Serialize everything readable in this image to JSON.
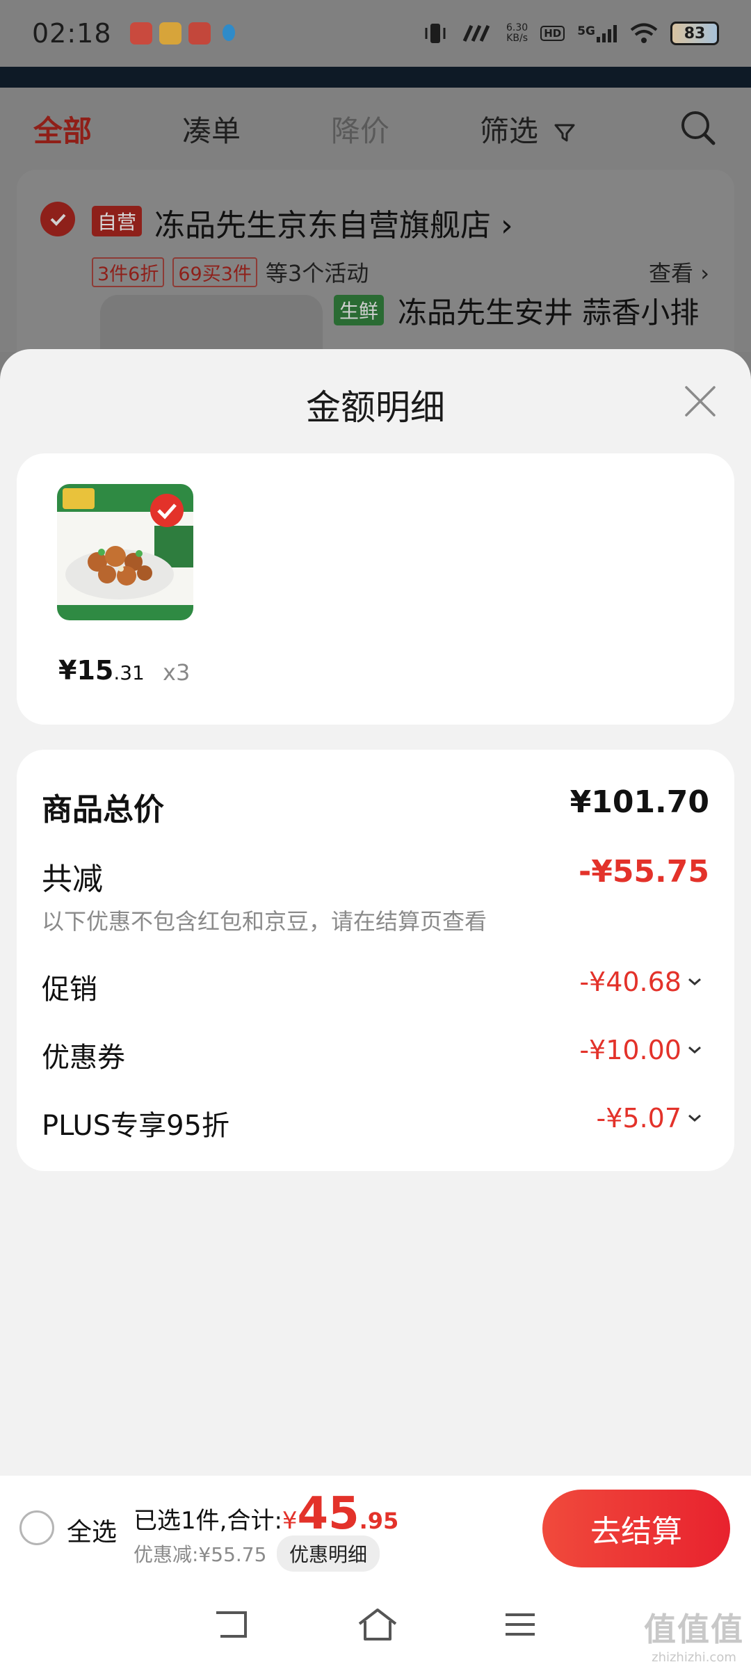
{
  "status_bar": {
    "time": "02:18",
    "net_speed_top": "6.30",
    "net_speed_bottom": "KB/s",
    "hd": "HD",
    "network": "5G",
    "battery": "83"
  },
  "tabs": [
    {
      "label": "全部"
    },
    {
      "label": "凑单"
    },
    {
      "label": "降价"
    },
    {
      "label": "筛选"
    }
  ],
  "store": {
    "badge": "自营",
    "name": "冻品先生京东自营旗舰店 ›",
    "promos": [
      "3件6折",
      "69买3件"
    ],
    "promo_more": "等3个活动",
    "view": "查看 ›",
    "fresh_badge": "生鲜",
    "product_name": "冻品先生安井 蒜香小排"
  },
  "sheet": {
    "title": "金额明细",
    "item": {
      "price_main": "¥15",
      "price_dec": ".31",
      "qty": "x3"
    },
    "total_label": "商品总价",
    "total_value": "¥101.70",
    "reduce_label": "共减",
    "reduce_value": "-¥55.75",
    "note": "以下优惠不包含红包和京豆，请在结算页查看",
    "lines": [
      {
        "label": "促销",
        "value": "-¥40.68"
      },
      {
        "label": "优惠券",
        "value": "-¥10.00"
      },
      {
        "label": "PLUS专享95折",
        "value": "-¥5.07"
      }
    ]
  },
  "action_bar": {
    "select_all": "全选",
    "selected_text": "已选1件,合计:",
    "currency": "¥",
    "total_int": "45",
    "total_dec": ".95",
    "discount_text": "优惠减:¥55.75",
    "detail_pill": "优惠明细",
    "checkout": "去结算"
  },
  "watermark": {
    "big": "值值值",
    "small": "zhizhizhi.com"
  },
  "colors": {
    "accent_red": "#e3322a",
    "sheet_bg": "#f2f2f2"
  }
}
